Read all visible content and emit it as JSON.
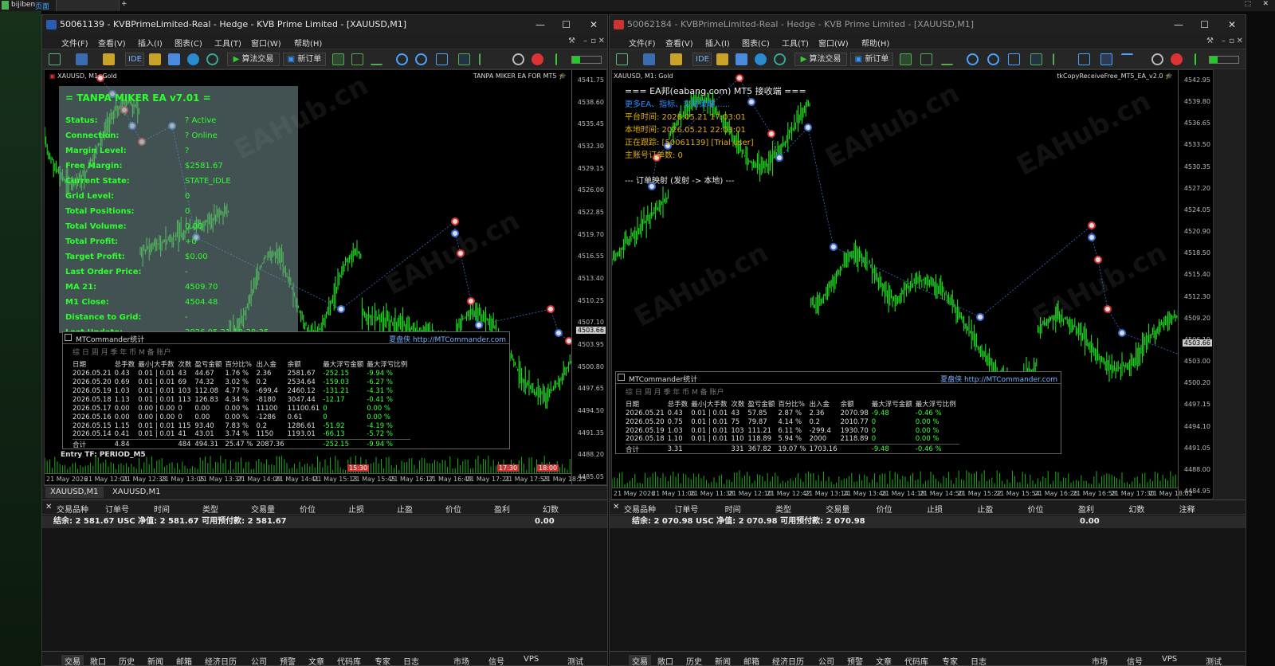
{
  "taskbar": {
    "label": "bijiben",
    "sublabel": "页面",
    "plus": "+"
  },
  "left": {
    "title": "50061139 - KVBPrimeLimited-Real - Hedge - KVB Prime Limited - [XAUUSD,M1]",
    "menu": [
      "文件(F)",
      "查看(V)",
      "插入(I)",
      "图表(C)",
      "工具(T)",
      "窗口(W)",
      "帮助(H)"
    ],
    "toolbar": {
      "algo": "算法交易",
      "neworder": "新订单",
      "ide": "IDE"
    },
    "chart_label": "XAUUSD, M1: Gold",
    "ea_label": "TANPA MIKER EA FOR MT5",
    "price_ticks": [
      "4541.75",
      "4538.60",
      "4535.45",
      "4532.30",
      "4529.15",
      "4526.00",
      "4522.85",
      "4519.70",
      "4516.55",
      "4513.40",
      "4510.25",
      "4507.10",
      "4503.95",
      "4500.80",
      "4497.65",
      "4494.50",
      "4491.35",
      "4488.20",
      "4485.05"
    ],
    "current_price": "4503.66",
    "time_ticks": [
      "21 May 2026",
      "21 May 12:01",
      "21 May 12:33",
      "21 May 13:05",
      "21 May 13:37",
      "21 May 14:09",
      "21 May 14:41",
      "21 May 15:13",
      "21 May 15:45",
      "21 May 16:17",
      "21 May 16:49",
      "21 May 17:21",
      "21 May 17:53",
      "21 May 18:25"
    ],
    "time_markers": [
      "15:30",
      "17:30",
      "18:00"
    ],
    "panel": {
      "title": "= TANPA MIKER EA v7.01 =",
      "rows": [
        {
          "k": "Status:",
          "v": "? Active"
        },
        {
          "k": "Connection:",
          "v": "? Online"
        },
        {
          "k": "Margin Level:",
          "v": "?"
        },
        {
          "k": "Free Margin:",
          "v": "$2581.67"
        },
        {
          "k": "Current State:",
          "v": "STATE_IDLE"
        },
        {
          "k": "Grid Level:",
          "v": "0"
        },
        {
          "k": "Total Positions:",
          "v": "0"
        },
        {
          "k": "Total Volume:",
          "v": "0.00"
        },
        {
          "k": "Total Profit:",
          "v": "+0"
        },
        {
          "k": "Target Profit:",
          "v": "$0.00"
        },
        {
          "k": "Last Order Price:",
          "v": "-"
        },
        {
          "k": "MA 21:",
          "v": "4509.70"
        },
        {
          "k": "M1 Close:",
          "v": "4504.48"
        },
        {
          "k": "Distance to Grid:",
          "v": "-"
        },
        {
          "k": "Last Update:",
          "v": "2026.05.21 18:28:35"
        }
      ],
      "entry_tf": "Entry TF: PERIOD_M5"
    },
    "stats": {
      "title": "MTCommander统计",
      "link": "夏盘侠 http://MTCommander.com",
      "tabs": "综 日 周 月 季 年 币 M 备 账户",
      "headers": [
        "日期",
        "总手数",
        "最小|大手数",
        "次数",
        "盈亏金额",
        "百分比%",
        "出入金",
        "余额",
        "最大浮亏金额",
        "最大浮亏比例"
      ],
      "rows": [
        [
          "2026.05.21",
          "0.43",
          "0.01 | 0.01",
          "43",
          "44.67",
          "1.76 %",
          "2.36",
          "2581.67",
          "-252.15",
          "-9.94 %"
        ],
        [
          "2026.05.20",
          "0.69",
          "0.01 | 0.01",
          "69",
          "74.32",
          "3.02 %",
          "0.2",
          "2534.64",
          "-159.03",
          "-6.27 %"
        ],
        [
          "2026.05.19",
          "1.03",
          "0.01 | 0.01",
          "103",
          "112.08",
          "4.77 %",
          "-699.4",
          "2460.12",
          "-131.21",
          "-4.31 %"
        ],
        [
          "2026.05.18",
          "1.13",
          "0.01 | 0.01",
          "113",
          "126.83",
          "4.34 %",
          "-8180",
          "3047.44",
          "-12.17",
          "-0.41 %"
        ],
        [
          "2026.05.17",
          "0.00",
          "0.00 | 0.00",
          "0",
          "0.00",
          "0.00 %",
          "11100",
          "11100.61",
          "0",
          "0.00 %"
        ],
        [
          "2026.05.16",
          "0.00",
          "0.00 | 0.00",
          "0",
          "0.00",
          "0.00 %",
          "-1286",
          "0.61",
          "0",
          "0.00 %"
        ],
        [
          "2026.05.15",
          "1.15",
          "0.01 | 0.01",
          "115",
          "93.40",
          "7.83 %",
          "0.2",
          "1286.61",
          "-51.92",
          "-4.19 %"
        ],
        [
          "2026.05.14",
          "0.41",
          "0.01 | 0.01",
          "41",
          "43.01",
          "3.74 %",
          "1150",
          "1193.01",
          "-66.13",
          "-5.72 %"
        ],
        [
          "合计",
          "4.84",
          "",
          "484",
          "494.31",
          "25.47 %",
          "2087.36",
          "",
          "-252.15",
          "-9.94 %"
        ]
      ]
    },
    "chart_tabs": [
      "XAUUSD,M1",
      "XAUUSD,M1"
    ],
    "term_headers": [
      "交易品种",
      "订单号",
      "时间",
      "类型",
      "交易量",
      "价位",
      "止损",
      "止盈",
      "价位",
      "盈利",
      "幻数"
    ],
    "balance": "结余: 2 581.67 USC  净值: 2 581.67  可用预付款: 2 581.67",
    "balance_profit": "0.00",
    "bottom_tabs": [
      "交易",
      "敞口",
      "历史",
      "新闻",
      "邮箱",
      "经济日历",
      "公司",
      "预警",
      "文章",
      "代码库",
      "专家",
      "日志"
    ],
    "bottom_right": [
      "市场",
      "信号",
      "VPS",
      "测试"
    ]
  },
  "right": {
    "title": "50062184 - KVBPrimeLimited-Real - Hedge - KVB Prime Limited - [XAUUSD,M1]",
    "menu": [
      "文件(F)",
      "查看(V)",
      "插入(I)",
      "图表(C)",
      "工具(T)",
      "窗口(W)",
      "帮助(H)"
    ],
    "toolbar": {
      "algo": "算法交易",
      "neworder": "新订单",
      "ide": "IDE"
    },
    "chart_label": "XAUUSD, M1: Gold",
    "ea_label": "tkCopyReceiveFree_MT5_EA_v2.0",
    "price_ticks": [
      "4542.95",
      "4539.80",
      "4536.65",
      "4533.50",
      "4530.35",
      "4527.20",
      "4524.05",
      "4520.90",
      "4518.50",
      "4515.40",
      "4512.30",
      "4509.20",
      "4506.10",
      "4503.00",
      "4500.20",
      "4497.15",
      "4494.10",
      "4491.05",
      "4488.00",
      "4484.95"
    ],
    "current_price": "4503.66",
    "time_ticks": [
      "21 May 2026",
      "21 May 11:06",
      "21 May 11:38",
      "21 May 12:10",
      "21 May 12:42",
      "21 May 13:14",
      "21 May 13:46",
      "21 May 14:18",
      "21 May 14:50",
      "21 May 15:22",
      "21 May 15:54",
      "21 May 16:26",
      "21 May 16:58",
      "21 May 17:30",
      "21 May 18:02"
    ],
    "copier": {
      "title": "=== EA邦(eabang.com) MT5 接收端 ===",
      "links": "更多EA、指标、交易策略......",
      "platform_time": "平台时间: 2026.05.21 17:03:01",
      "local_time": "本地时间: 2026.05.21 22:03:01",
      "following": "正在跟踪: [50061139] [Trial user]",
      "main_orders": "主账号订单数: 0",
      "mapping": "--- 订单映射 (发射 -> 本地) ---"
    },
    "stats": {
      "title": "MTCommander统计",
      "link": "夏盘侠 http://MTCommander.com",
      "tabs": "综 日 周 月 季 年 币 M 备 账户",
      "headers": [
        "日期",
        "总手数",
        "最小|大手数",
        "次数",
        "盈亏金额",
        "百分比%",
        "出入金",
        "余额",
        "最大浮亏金额",
        "最大浮亏比例"
      ],
      "rows": [
        [
          "2026.05.21",
          "0.43",
          "0.01 | 0.01",
          "43",
          "57.85",
          "2.87 %",
          "2.36",
          "2070.98",
          "-9.48",
          "-0.46 %"
        ],
        [
          "2026.05.20",
          "0.75",
          "0.01 | 0.01",
          "75",
          "79.87",
          "4.14 %",
          "0.2",
          "2010.77",
          "0",
          "0.00 %"
        ],
        [
          "2026.05.19",
          "1.03",
          "0.01 | 0.01",
          "103",
          "111.21",
          "6.11 %",
          "-299.4",
          "1930.70",
          "0",
          "0.00 %"
        ],
        [
          "2026.05.18",
          "1.10",
          "0.01 | 0.01",
          "110",
          "118.89",
          "5.94 %",
          "2000",
          "2118.89",
          "0",
          "0.00 %"
        ],
        [
          "合计",
          "3.31",
          "",
          "331",
          "367.82",
          "19.07 %",
          "1703.16",
          "",
          "-9.48",
          "-0.46 %"
        ]
      ]
    },
    "term_headers": [
      "交易品种",
      "订单号",
      "时间",
      "类型",
      "交易量",
      "价位",
      "止损",
      "止盈",
      "价位",
      "盈利",
      "幻数",
      "注释"
    ],
    "balance": "结余: 2 070.98 USC  净值: 2 070.98  可用预付款: 2 070.98",
    "balance_profit": "0.00",
    "bottom_tabs": [
      "交易",
      "敞口",
      "历史",
      "新闻",
      "邮箱",
      "经济日历",
      "公司",
      "预警",
      "文章",
      "代码库",
      "专家",
      "日志"
    ],
    "bottom_right": [
      "市场",
      "信号",
      "VPS",
      "测试"
    ]
  },
  "watermark": "EAHub.cn",
  "colors": {
    "candle": "#22dd22",
    "chart_bg": "#000000",
    "panel_text": "#2dff2d",
    "copier_text": "#e0b000",
    "copier_link": "#2e8bff"
  }
}
